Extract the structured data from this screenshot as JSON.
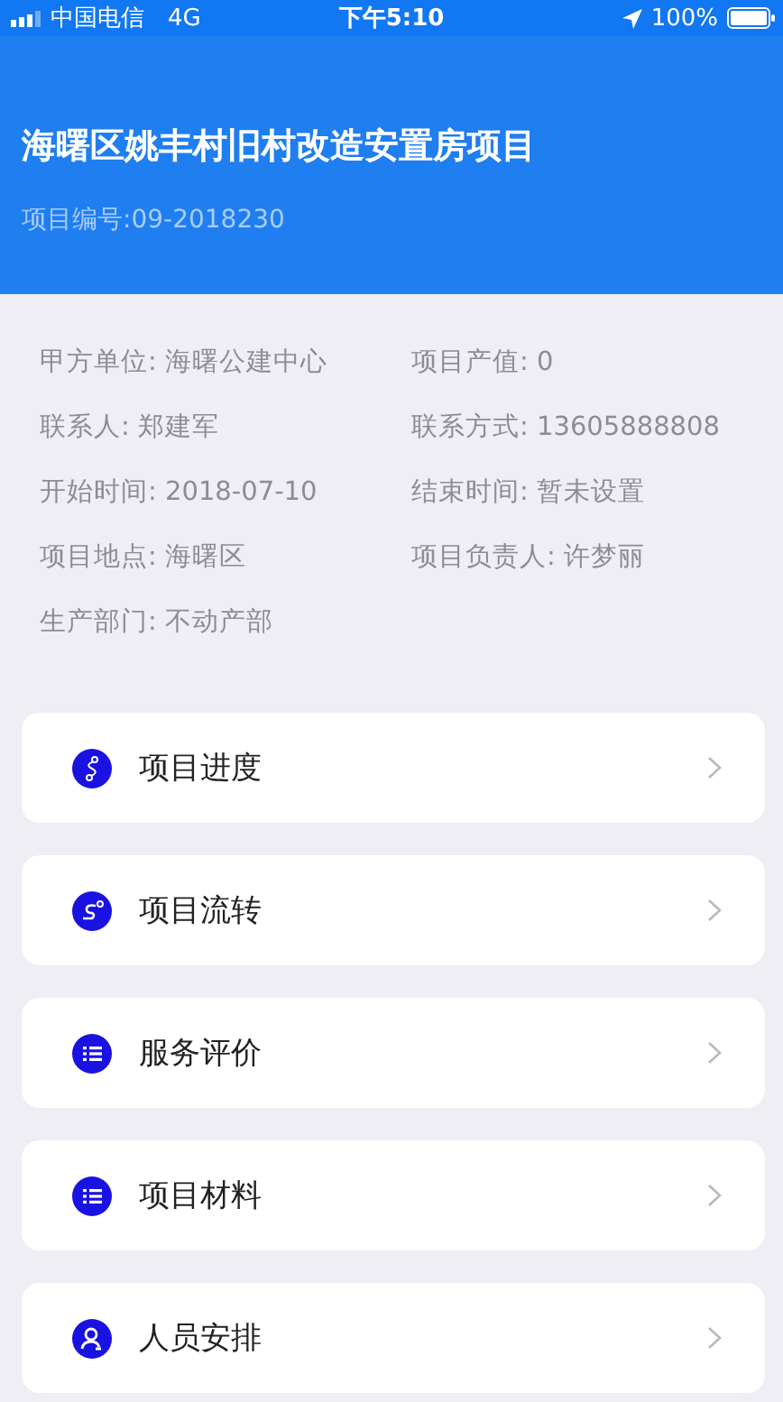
{
  "status_bar": {
    "carrier": "中国电信",
    "network": "4G",
    "time": "下午5:10",
    "battery": "100%"
  },
  "header": {
    "title": "海曙区姚丰村旧村改造安置房项目",
    "code": "项目编号:09-2018230"
  },
  "info": [
    {
      "label": "甲方单位:",
      "value": "海曙公建中心"
    },
    {
      "label": "项目产值:",
      "value": "0"
    },
    {
      "label": "联系人:",
      "value": "郑建军"
    },
    {
      "label": "联系方式:",
      "value": "13605888808"
    },
    {
      "label": "开始时间:",
      "value": "2018-07-10"
    },
    {
      "label": "结束时间:",
      "value": "暂未设置"
    },
    {
      "label": "项目地点:",
      "value": "海曙区"
    },
    {
      "label": "项目负责人:",
      "value": "许梦丽"
    },
    {
      "label": "生产部门:",
      "value": "不动产部"
    }
  ],
  "menu": [
    {
      "label": "项目进度",
      "kind": "progress"
    },
    {
      "label": "项目流转",
      "kind": "flow"
    },
    {
      "label": "服务评价",
      "kind": "list"
    },
    {
      "label": "项目材料",
      "kind": "list"
    },
    {
      "label": "人员安排",
      "kind": "person"
    }
  ]
}
